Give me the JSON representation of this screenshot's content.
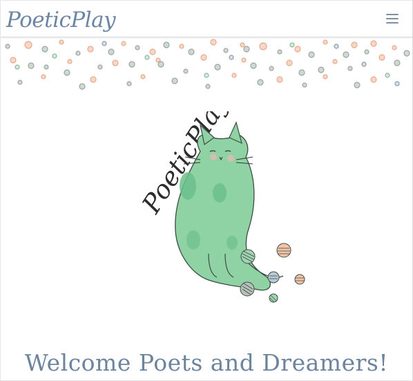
{
  "header": {
    "logo_text": "PoeticPlay",
    "menu_icon": "hamburger-menu-icon"
  },
  "hero": {
    "logo_text": "PoeticPlay",
    "illustration": "cat-with-yarn-balls"
  },
  "welcome": {
    "heading": "Welcome Poets and Dreamers!"
  },
  "colors": {
    "logo_ink": "#6d85a4",
    "heading_ink": "#6d849f",
    "cat_green": "#8fd3a5",
    "cat_green_dark": "#6bbf8a",
    "dot_peach": "#f2c4a7",
    "dot_gray": "#b7c1bb",
    "dot_green": "#bcd7c3",
    "dot_blue": "#b9c9d6"
  }
}
